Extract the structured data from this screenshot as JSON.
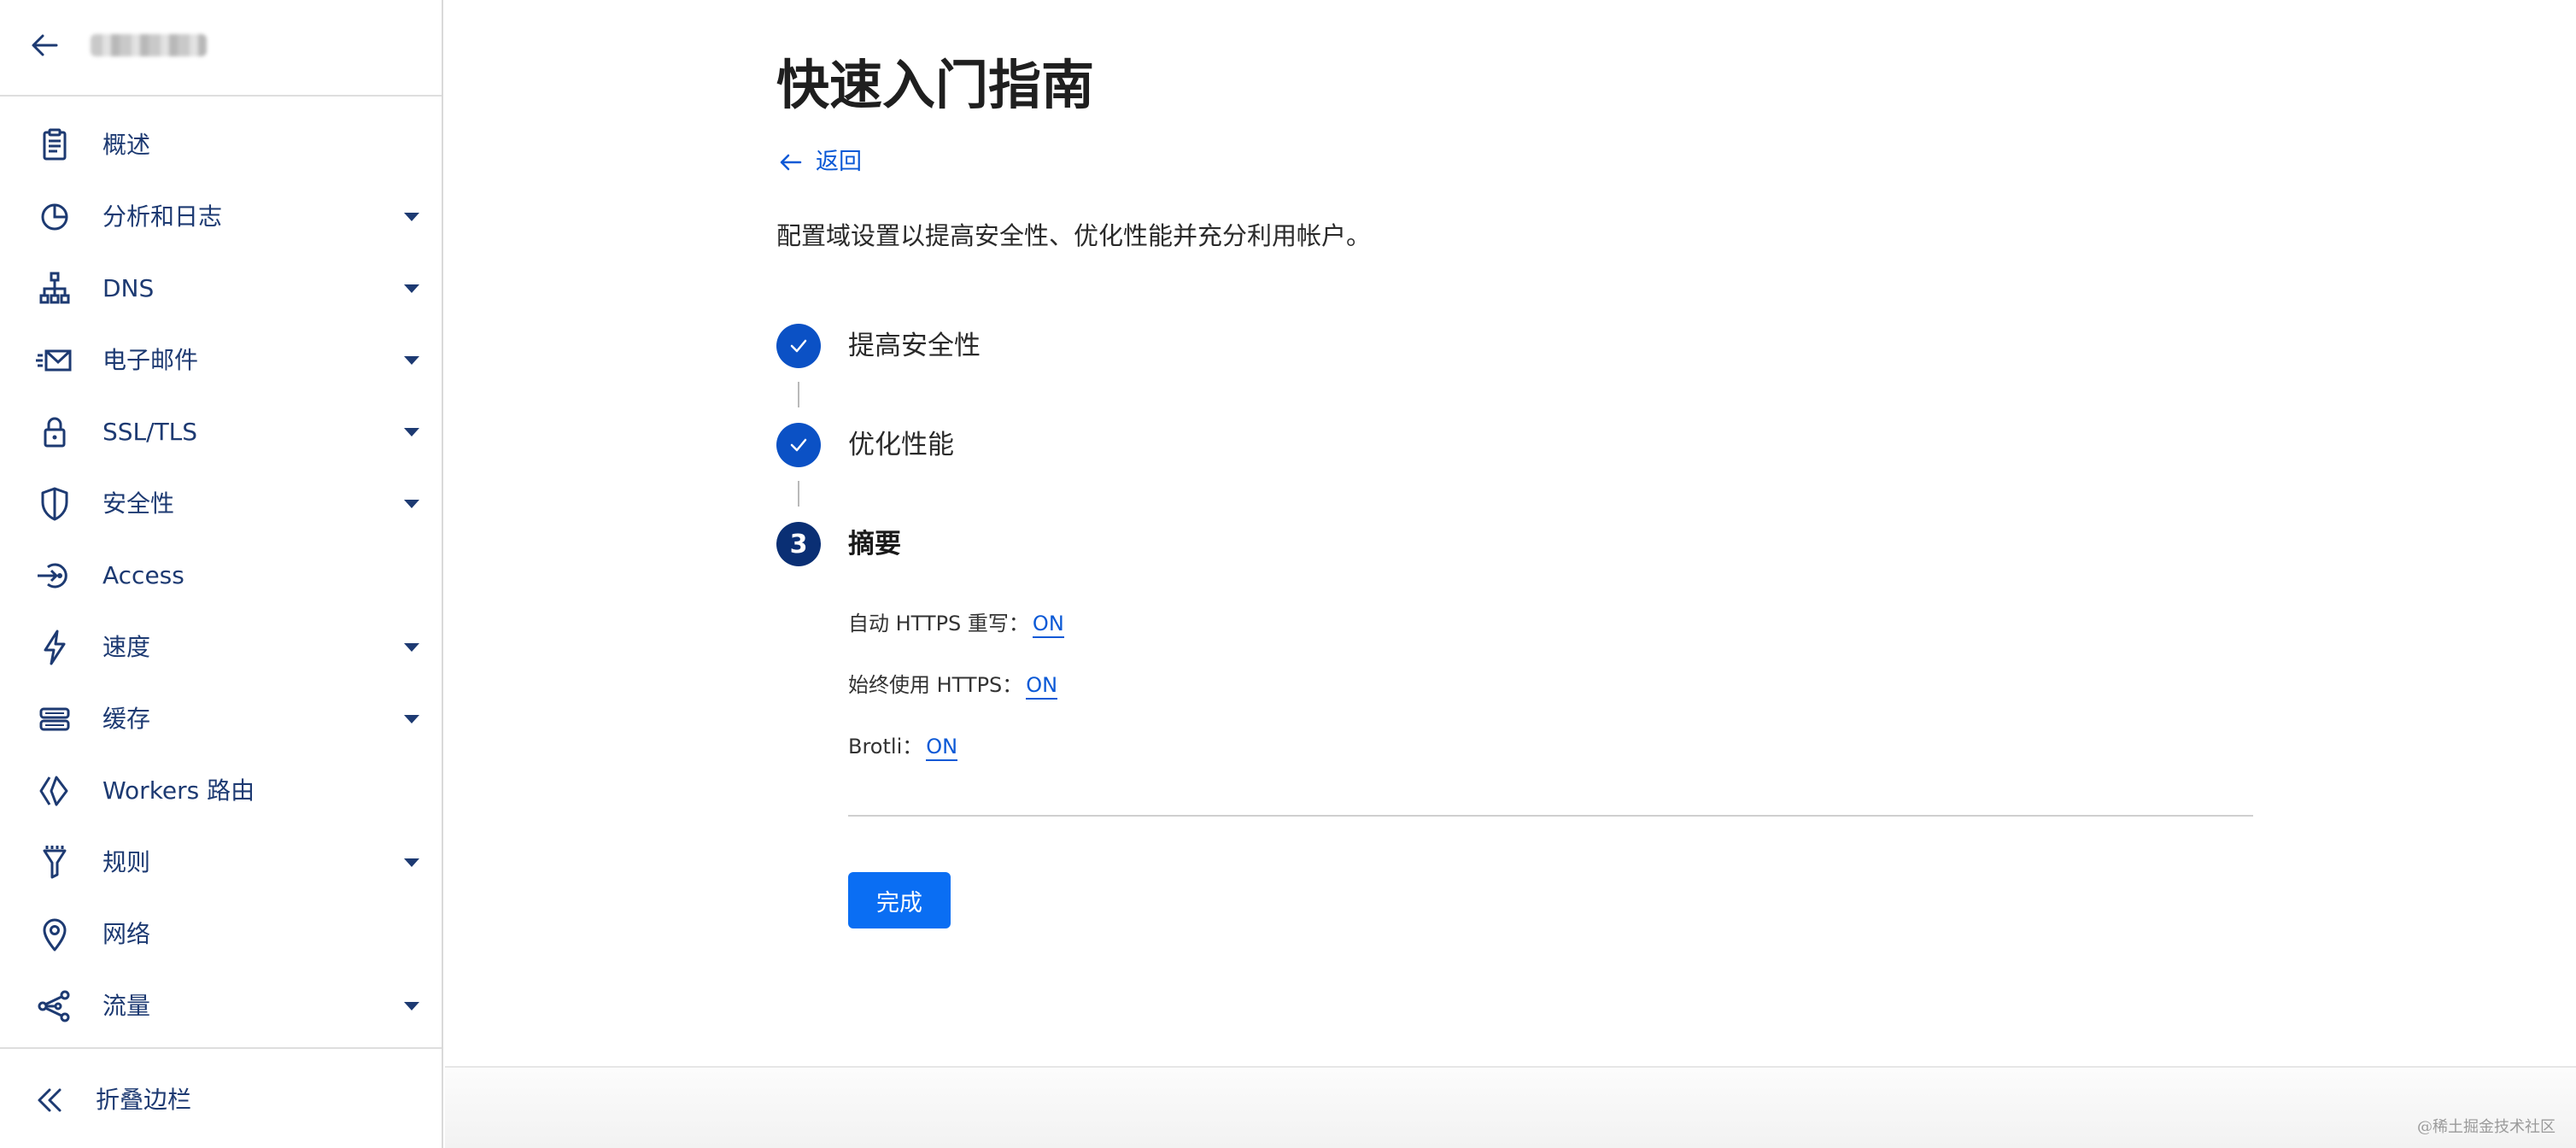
{
  "sidebar": {
    "back_icon": "arrow-left-icon",
    "items": [
      {
        "label": "概述",
        "icon": "clipboard-icon",
        "expandable": false
      },
      {
        "label": "分析和日志",
        "icon": "pie-chart-icon",
        "expandable": true
      },
      {
        "label": "DNS",
        "icon": "network-tree-icon",
        "expandable": true
      },
      {
        "label": "电子邮件",
        "icon": "email-icon",
        "expandable": true
      },
      {
        "label": "SSL/TLS",
        "icon": "lock-icon",
        "expandable": true
      },
      {
        "label": "安全性",
        "icon": "shield-icon",
        "expandable": true
      },
      {
        "label": "Access",
        "icon": "access-icon",
        "expandable": false
      },
      {
        "label": "速度",
        "icon": "lightning-icon",
        "expandable": true
      },
      {
        "label": "缓存",
        "icon": "server-stack-icon",
        "expandable": true
      },
      {
        "label": "Workers 路由",
        "icon": "workers-icon",
        "expandable": false
      },
      {
        "label": "规则",
        "icon": "funnel-icon",
        "expandable": true
      },
      {
        "label": "网络",
        "icon": "location-pin-icon",
        "expandable": false
      },
      {
        "label": "流量",
        "icon": "share-nodes-icon",
        "expandable": true
      }
    ],
    "collapse_label": "折叠边栏"
  },
  "main": {
    "title": "快速入门指南",
    "back_label": "返回",
    "description": "配置域设置以提高安全性、优化性能并充分利用帐户。",
    "steps": [
      {
        "label": "提高安全性",
        "status": "complete"
      },
      {
        "label": "优化性能",
        "status": "complete"
      },
      {
        "label": "摘要",
        "status": "current",
        "number": "3"
      }
    ],
    "settings": [
      {
        "label": "自动 HTTPS 重写：",
        "value": "ON"
      },
      {
        "label": "始终使用 HTTPS：",
        "value": "ON"
      },
      {
        "label": "Brotli：",
        "value": "ON"
      }
    ],
    "done_label": "完成"
  },
  "watermark": "@稀土掘金技术社区",
  "colors": {
    "nav_text": "#1d3a72",
    "link": "#0b59d6",
    "step_complete": "#0b51c5",
    "step_current": "#0a2f74",
    "primary_button": "#0a6ef3"
  }
}
